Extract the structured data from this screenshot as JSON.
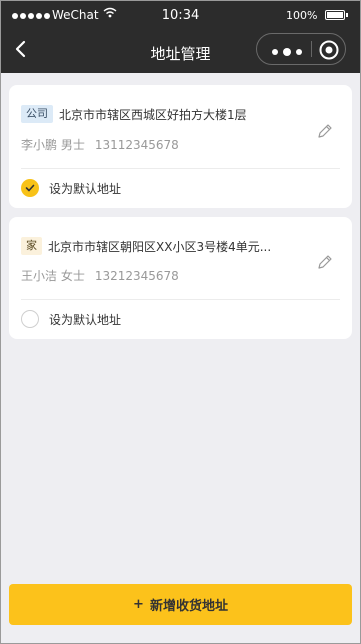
{
  "status_bar": {
    "carrier": "WeChat",
    "time": "10:34",
    "battery": "100%"
  },
  "nav": {
    "title": "地址管理"
  },
  "addresses": [
    {
      "tag": "公司",
      "address": "北京市市辖区西城区好拍方大楼1层",
      "name": "李小鹏 男士",
      "phone": "13112345678",
      "default_label": "设为默认地址",
      "is_default": true
    },
    {
      "tag": "家",
      "address": "北京市市辖区朝阳区XX小区3号楼4单元...",
      "name": "王小洁 女士",
      "phone": "13212345678",
      "default_label": "设为默认地址",
      "is_default": false
    }
  ],
  "add_button": {
    "plus": "+",
    "label": "新增收货地址"
  },
  "colors": {
    "accent": "#fcc21b",
    "nav_background": "#2c2c2c",
    "page_background": "#eeeef2"
  }
}
